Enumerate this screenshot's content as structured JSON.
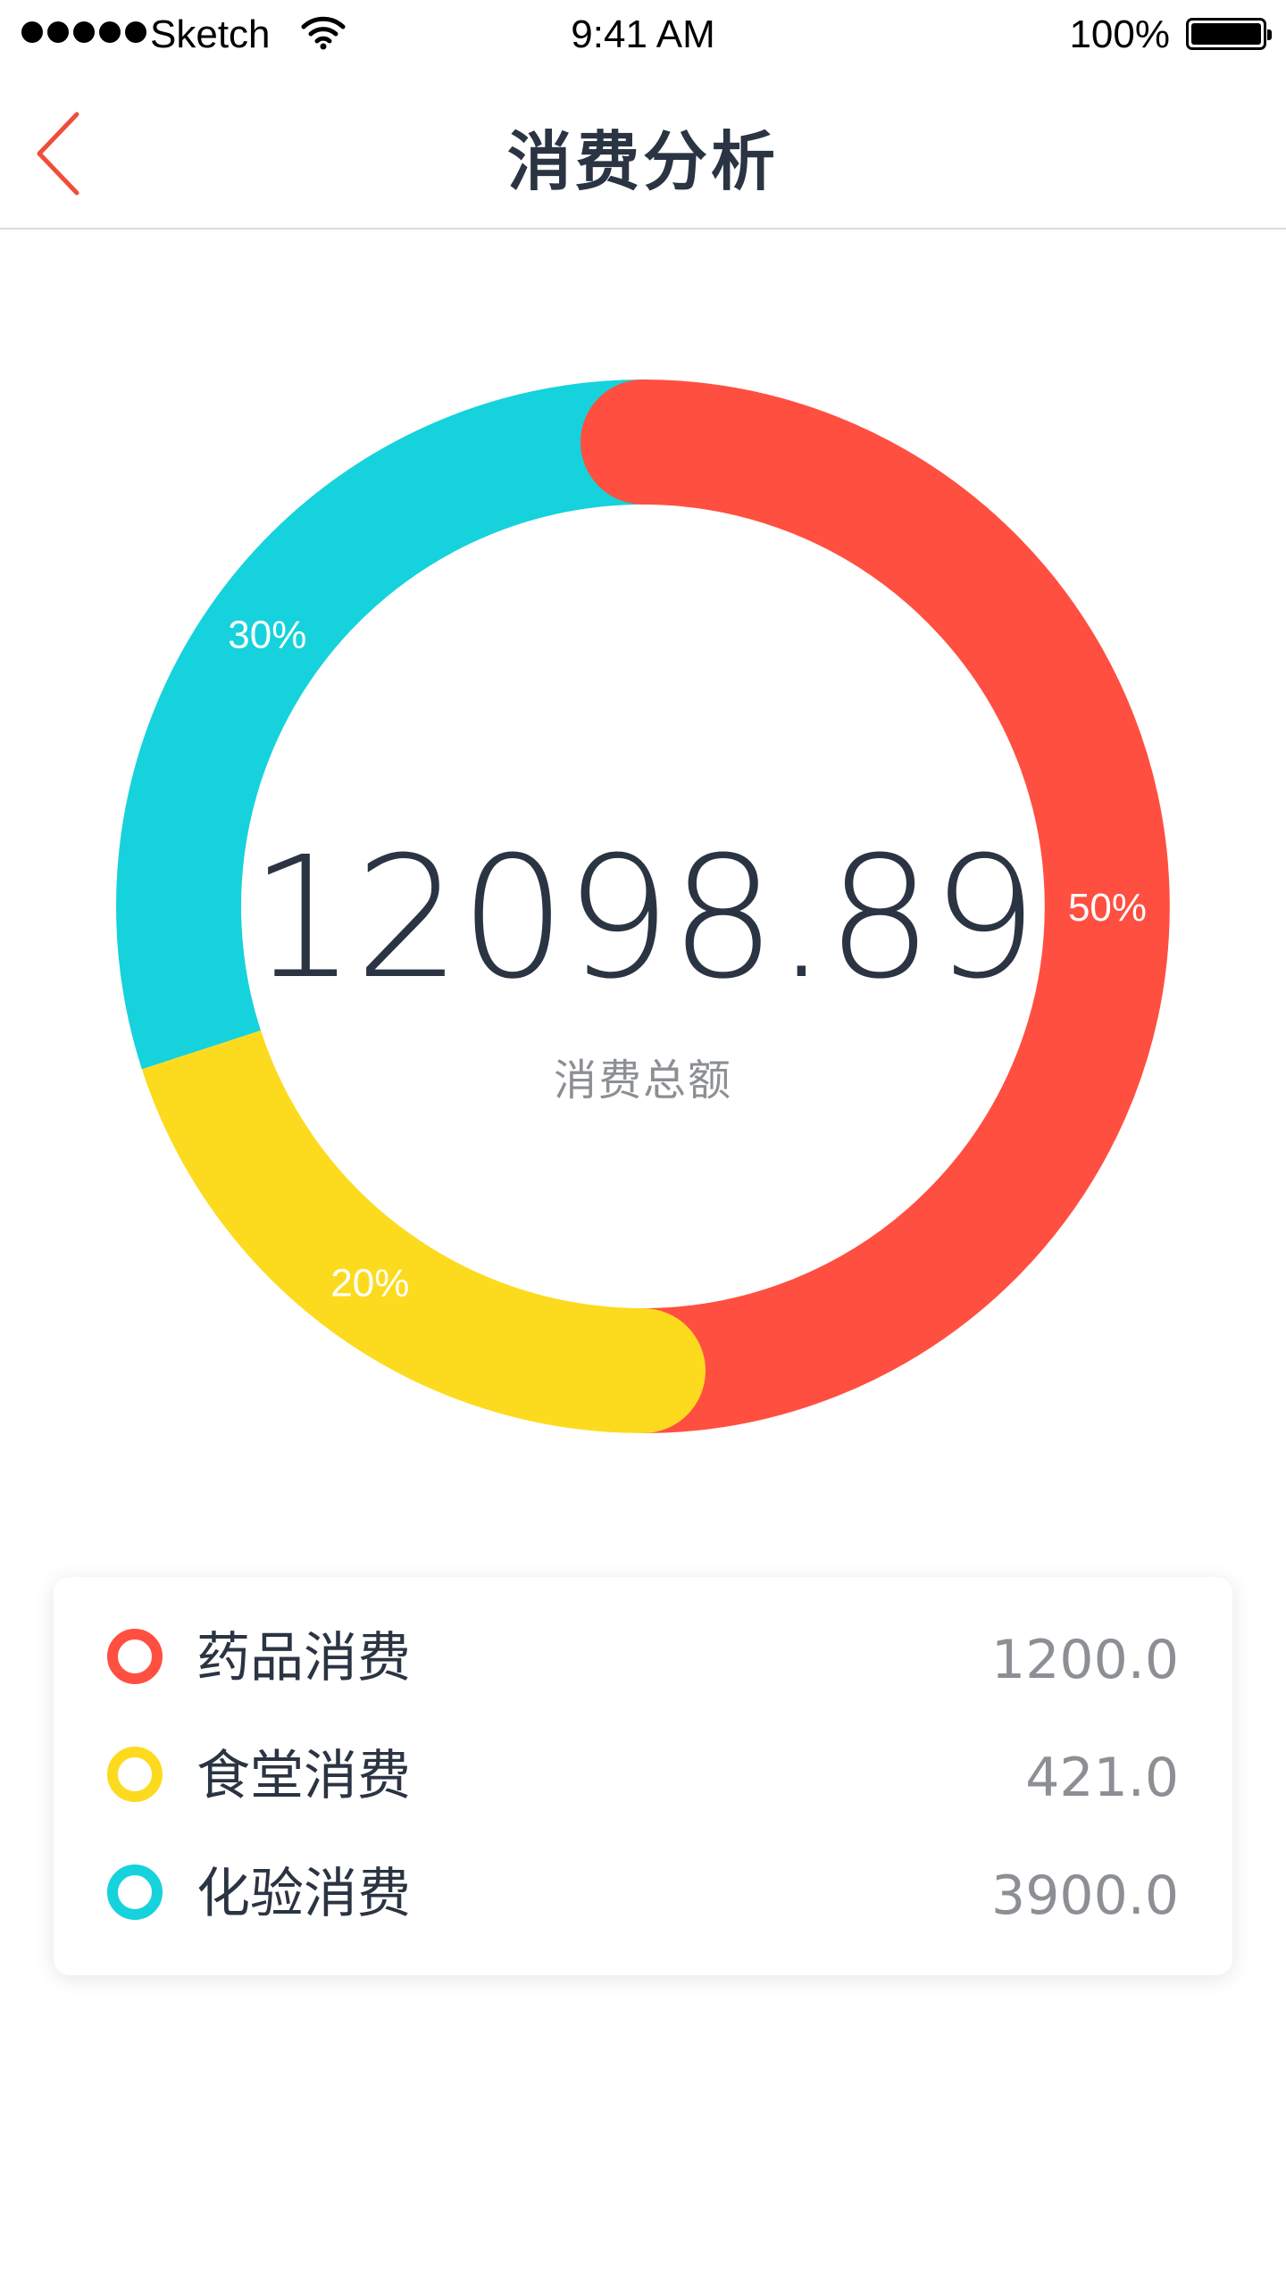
{
  "status_bar": {
    "carrier": "Sketch",
    "time": "9:41 AM",
    "battery_percent": "100%"
  },
  "nav": {
    "title": "消费分析",
    "back_icon": "chevron-left-icon"
  },
  "colors": {
    "medicine": "#ff4f40",
    "canteen": "#fcdb1f",
    "lab": "#16d2dc",
    "accent": "#f04d3a"
  },
  "chart_data": {
    "type": "pie",
    "style": "donut",
    "center_value": "12098.89",
    "center_label": "消费总额",
    "slices": [
      {
        "key": "medicine",
        "percent": 50,
        "label": "50%"
      },
      {
        "key": "canteen",
        "percent": 20,
        "label": "20%"
      },
      {
        "key": "lab",
        "percent": 30,
        "label": "30%"
      }
    ]
  },
  "legend": [
    {
      "key": "medicine",
      "label": "药品消费",
      "value": "1200.0"
    },
    {
      "key": "canteen",
      "label": "食堂消费",
      "value": "421.0"
    },
    {
      "key": "lab",
      "label": "化验消费",
      "value": "3900.0"
    }
  ]
}
